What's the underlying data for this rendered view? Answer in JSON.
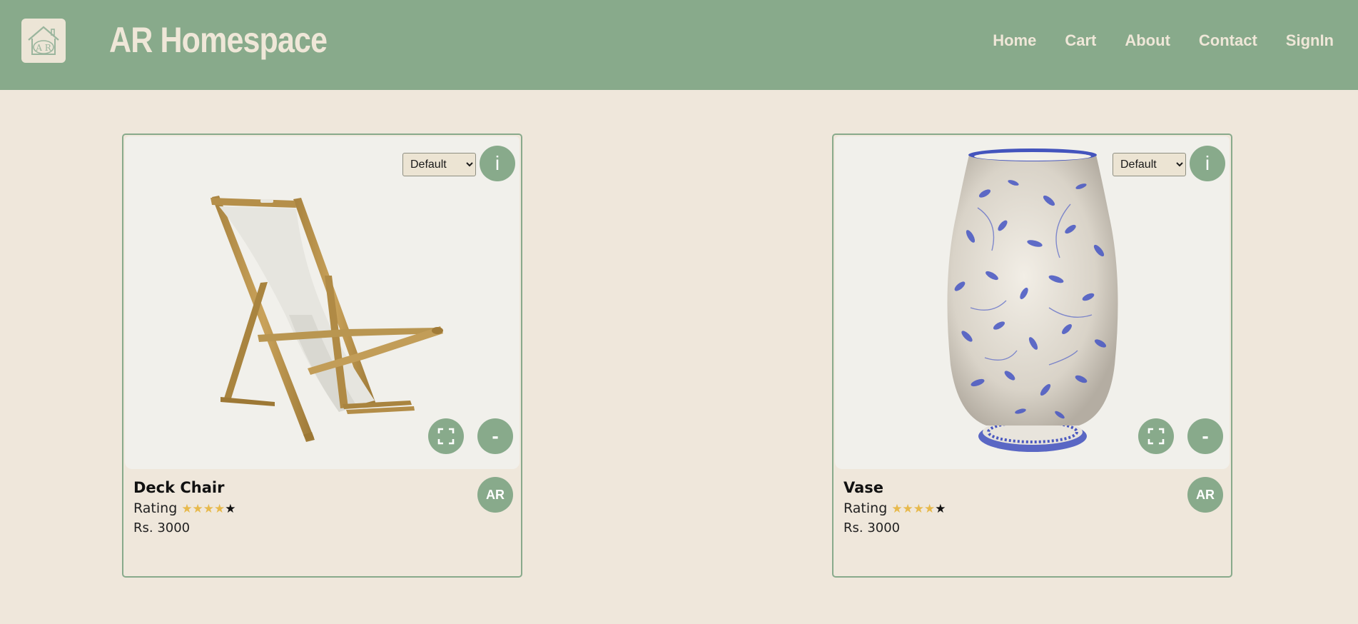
{
  "header": {
    "brand": "AR Homespace",
    "logo_text": "A R",
    "nav": [
      "Home",
      "Cart",
      "About",
      "Contact",
      "SignIn"
    ]
  },
  "colors": {
    "accent": "#88aa8b",
    "background": "#efe7db",
    "viewer_bg": "#f1f0eb",
    "star_on": "#e7b94c"
  },
  "products": [
    {
      "name": "Deck Chair",
      "rating_label": "Rating",
      "rating_value": 4,
      "rating_max": 5,
      "price": "Rs. 3000",
      "variant": "Default",
      "info_label": "i",
      "fullscreen_icon": "fullscreen-icon",
      "minus_label": "-",
      "ar_label": "AR"
    },
    {
      "name": "Vase",
      "rating_label": "Rating",
      "rating_value": 4,
      "rating_max": 5,
      "price": "Rs. 3000",
      "variant": "Default",
      "info_label": "i",
      "fullscreen_icon": "fullscreen-icon",
      "minus_label": "-",
      "ar_label": "AR"
    }
  ]
}
